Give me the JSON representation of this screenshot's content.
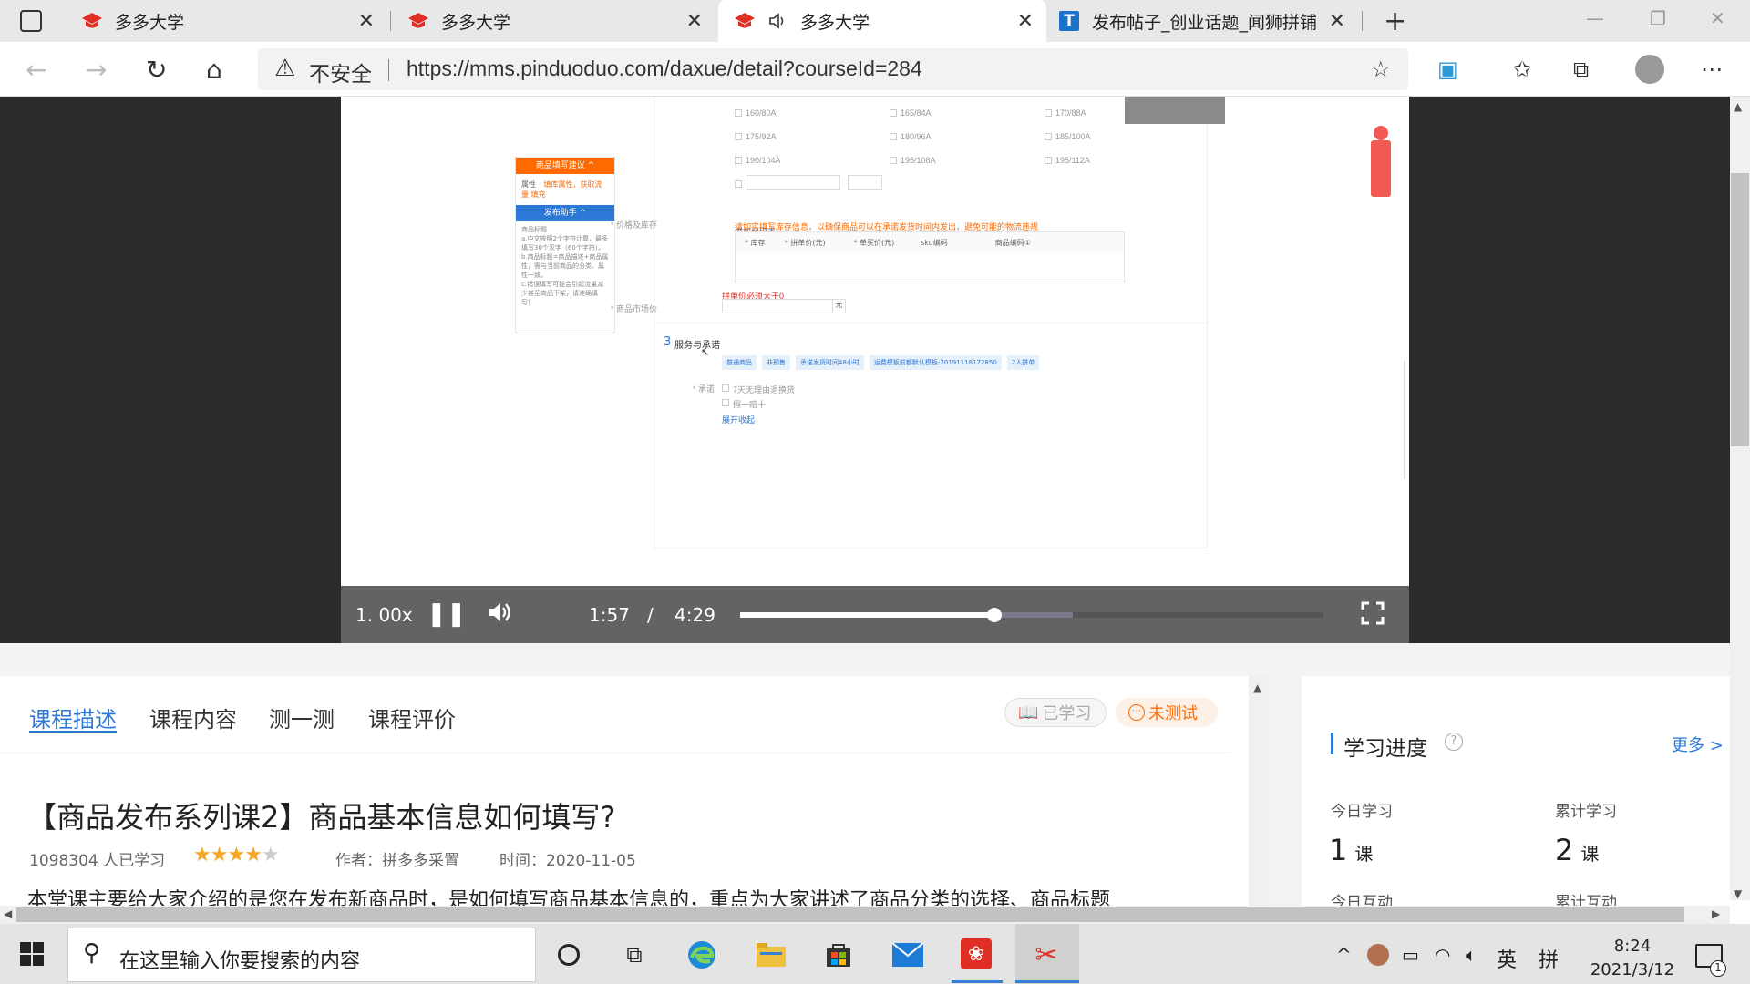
{
  "tabs": [
    {
      "title": "多多大学",
      "active": false
    },
    {
      "title": "多多大学",
      "active": false
    },
    {
      "title": "多多大学",
      "active": true
    },
    {
      "title": "发布帖子_创业话题_闻狮拼铺",
      "active": false
    }
  ],
  "address": {
    "security": "不安全",
    "url": "https://mms.pinduoduo.com/daxue/detail?courseId=284"
  },
  "player": {
    "speed": "1. 00x",
    "current": "1:57",
    "separator": "/",
    "duration": "4:29",
    "progress": 0.436,
    "buffered": 0.57
  },
  "video_page": {
    "sizes": [
      "160/80A",
      "165/84A",
      "170/88A",
      "175/92A",
      "180/96A",
      "185/100A",
      "190/104A",
      "195/108A",
      "195/112A"
    ],
    "side_tab1": "商品填写建议 ^",
    "side_tab1_text": "属性",
    "side_tab1_link": "填库属性，获取流量 填充",
    "side_tab2": "发布助手 ^",
    "side_tab2_lines": [
      "商品标题",
      "a.中文按照2个字符计算，最多填写30个汉字（60个字符）。",
      "b.商品标题=商品描述+商品属性，需与当前商品的分类、属性一致。",
      "c.错误填写可能会引起流量减少甚至商品下架，请准确填写！"
    ],
    "size_hint": "添加尺码表",
    "price_label": "* 价格及库存",
    "price_warn": "请如实填写库存信息，以确保商品可以在承诺发货时间内发出，避免可能的物流违规",
    "price_cols": [
      "* 库存",
      "* 拼单价(元)",
      "* 单买价(元)",
      "sku编码",
      "商品编码①"
    ],
    "price_err": "拼单价必须大于0",
    "market_label": "* 商品市场价",
    "market_unit": "元",
    "section_no": "3",
    "section_title": "服务与承诺",
    "service_tags": [
      "普通商品",
      "非预售",
      "承诺发货时间48小时",
      "运费模板前都默认模板-20191118172850",
      "2人拼单"
    ],
    "promise_label": "* 承诺",
    "promise_1": "7天无理由退换货",
    "promise_2": "假一赔十",
    "expand": "展开收起"
  },
  "course_tabs": [
    "课程描述",
    "课程内容",
    "测一测",
    "课程评价"
  ],
  "pills": {
    "learned": "已学习",
    "untested": "未测试"
  },
  "course": {
    "title": "【商品发布系列课2】商品基本信息如何填写?",
    "learners": "1098304 人已学习",
    "rating": 4,
    "author": "作者：拼多多采置",
    "time": "时间：2020-11-05",
    "desc": "本堂课主要给大家介绍的是您在发布新商品时，是如何填写商品基本信息的，重点为大家讲述了商品分类的选择、商品标题"
  },
  "progress_panel": {
    "title": "学习进度",
    "more": "更多 >",
    "today_label": "今日学习",
    "today_value": "1",
    "today_unit": "课",
    "total_label": "累计学习",
    "total_value": "2",
    "total_unit": "课",
    "today_interact": "今日互动",
    "total_interact": "累计互动"
  },
  "taskbar": {
    "search_placeholder": "在这里输入你要搜索的内容",
    "ime1": "英",
    "ime2": "拼",
    "time": "8:24",
    "date": "2021/3/12",
    "notif": "1"
  },
  "colors": {
    "accent": "#2c78d6",
    "orange": "#ff6a00",
    "pdd_red": "#e02e24"
  }
}
